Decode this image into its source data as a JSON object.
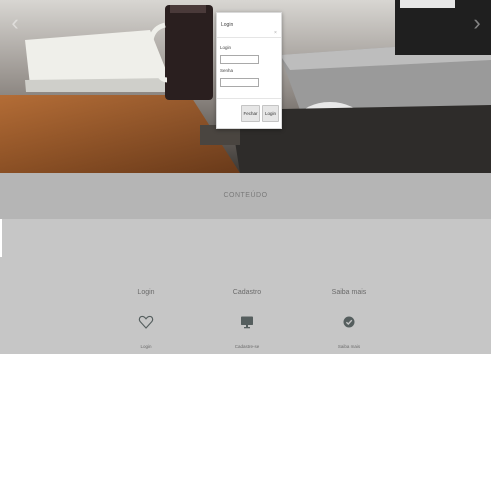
{
  "content_band": {
    "label": "CONTEÚDO"
  },
  "features": [
    {
      "title": "Login",
      "icon": "heart-icon",
      "link": "Login"
    },
    {
      "title": "Cadastro",
      "icon": "monitor-icon",
      "link": "Cadastre-se"
    },
    {
      "title": "Saiba mais",
      "icon": "check-circle-icon",
      "link": "Saiba mais"
    }
  ],
  "modal": {
    "title": "Login",
    "close_symbol": "×",
    "login_label": "Login",
    "password_label": "Senha",
    "login_value": "",
    "password_value": "",
    "cancel_button": "Fechar",
    "submit_button": "Login"
  },
  "carousel": {
    "prev_symbol": "‹",
    "next_symbol": "›"
  },
  "colors": {
    "accent": "#555e5e",
    "band": "#b5b5b5",
    "body": "#c6c6c6"
  }
}
